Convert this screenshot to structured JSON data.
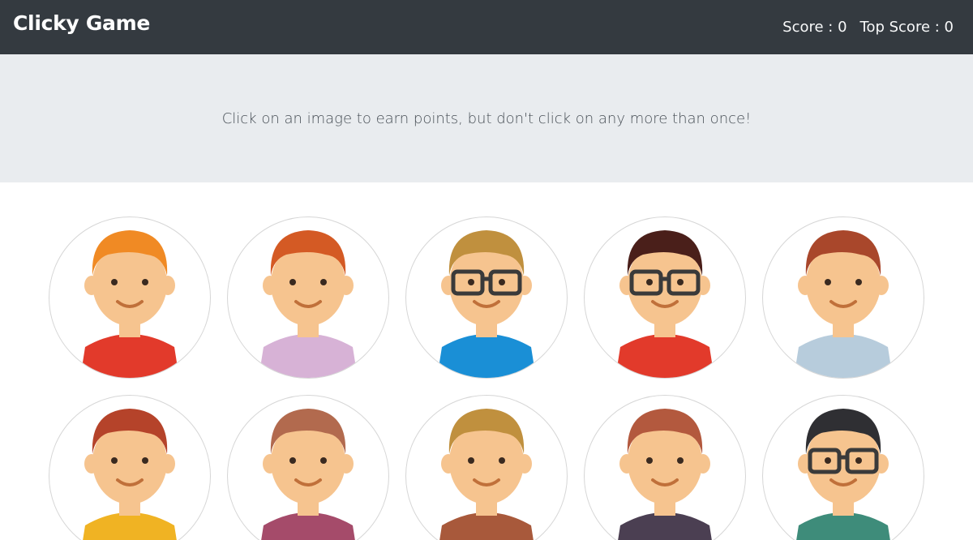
{
  "header": {
    "title": "Clicky Game",
    "score_text": "Score : 0",
    "top_score_text": "Top Score : 0"
  },
  "instructions": "Click on an image to earn points, but don't click on any more than once!",
  "avatars": [
    {
      "name": "avatar-orange-hair-man",
      "hair": "#f08a24",
      "skin": "#f6c48f",
      "shirt": "#e23a2b",
      "glasses": false
    },
    {
      "name": "avatar-red-hair-woman",
      "hair": "#d45a24",
      "skin": "#f6c48f",
      "shirt": "#d7b2d6",
      "glasses": false
    },
    {
      "name": "avatar-blonde-man-glasses",
      "hair": "#c0903e",
      "skin": "#f6c48f",
      "shirt": "#1a8fd6",
      "glasses": true
    },
    {
      "name": "avatar-dark-hair-woman-glasses",
      "hair": "#4a1f1a",
      "skin": "#f6c48f",
      "shirt": "#e23a2b",
      "glasses": true
    },
    {
      "name": "avatar-brown-hair-woman",
      "hair": "#a9472b",
      "skin": "#f6c48f",
      "shirt": "#b7ccdc",
      "glasses": false
    },
    {
      "name": "avatar-bearded-man",
      "hair": "#b5432a",
      "skin": "#f6c48f",
      "shirt": "#f0b323",
      "glasses": false
    },
    {
      "name": "avatar-bun-hair-woman",
      "hair": "#b26a4e",
      "skin": "#f6c48f",
      "shirt": "#a54b6a",
      "glasses": false
    },
    {
      "name": "avatar-blonde-man",
      "hair": "#c0903e",
      "skin": "#f6c48f",
      "shirt": "#a8593b",
      "glasses": false
    },
    {
      "name": "avatar-auburn-man",
      "hair": "#b3593e",
      "skin": "#f6c48f",
      "shirt": "#4b3f52",
      "glasses": false
    },
    {
      "name": "avatar-black-hair-woman-glasses",
      "hair": "#2f2f33",
      "skin": "#f6c48f",
      "shirt": "#3e8c7a",
      "glasses": true
    }
  ]
}
